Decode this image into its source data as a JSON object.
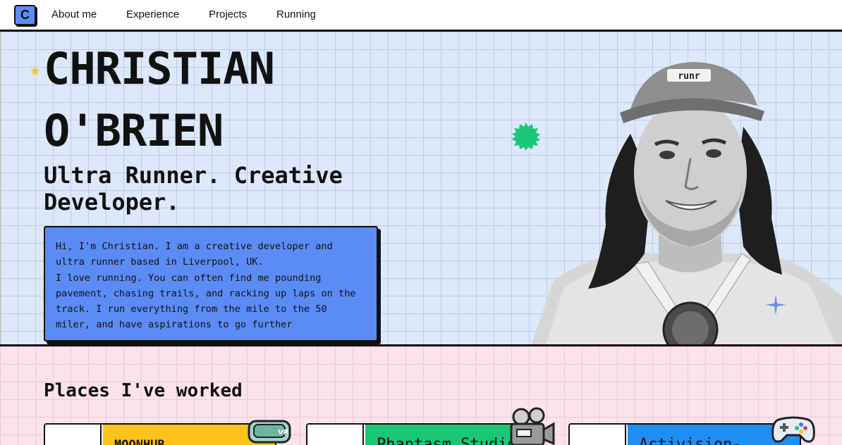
{
  "nav": {
    "logo_letter": "C",
    "items": [
      {
        "label": "About me"
      },
      {
        "label": "Experience"
      },
      {
        "label": "Projects"
      },
      {
        "label": "Running"
      }
    ]
  },
  "hero": {
    "name_line1": "CHRISTIAN",
    "name_line2": "O'BRIEN",
    "tagline": "Ultra Runner. Creative Developer.",
    "bio_p1": "Hi, I'm Christian. I am a creative developer and ultra runner based in Liverpool, UK.",
    "bio_p2": "I love running. You can often find me pounding pavement, chasing trails, and racking up laps on the track. I run everything from the mile to the 50 miler, and have aspirations to go further",
    "cap_text": "runr"
  },
  "work": {
    "title": "Places I've worked",
    "cards": [
      {
        "label": "MOONHUB",
        "color": "#ffc21a",
        "icon": "vr-headset-icon"
      },
      {
        "label": "Phantasm Studio",
        "color": "#19c777",
        "icon": "film-camera-icon"
      },
      {
        "label": "Activision-",
        "color": "#1f8ef2",
        "icon": "gamepad-icon"
      }
    ]
  },
  "colors": {
    "hero_bg": "#dde9fb",
    "bio_bg": "#5b8cf5",
    "work_bg": "#fbe3ec",
    "accent_green": "#19c777",
    "accent_yellow": "#f3c623"
  }
}
